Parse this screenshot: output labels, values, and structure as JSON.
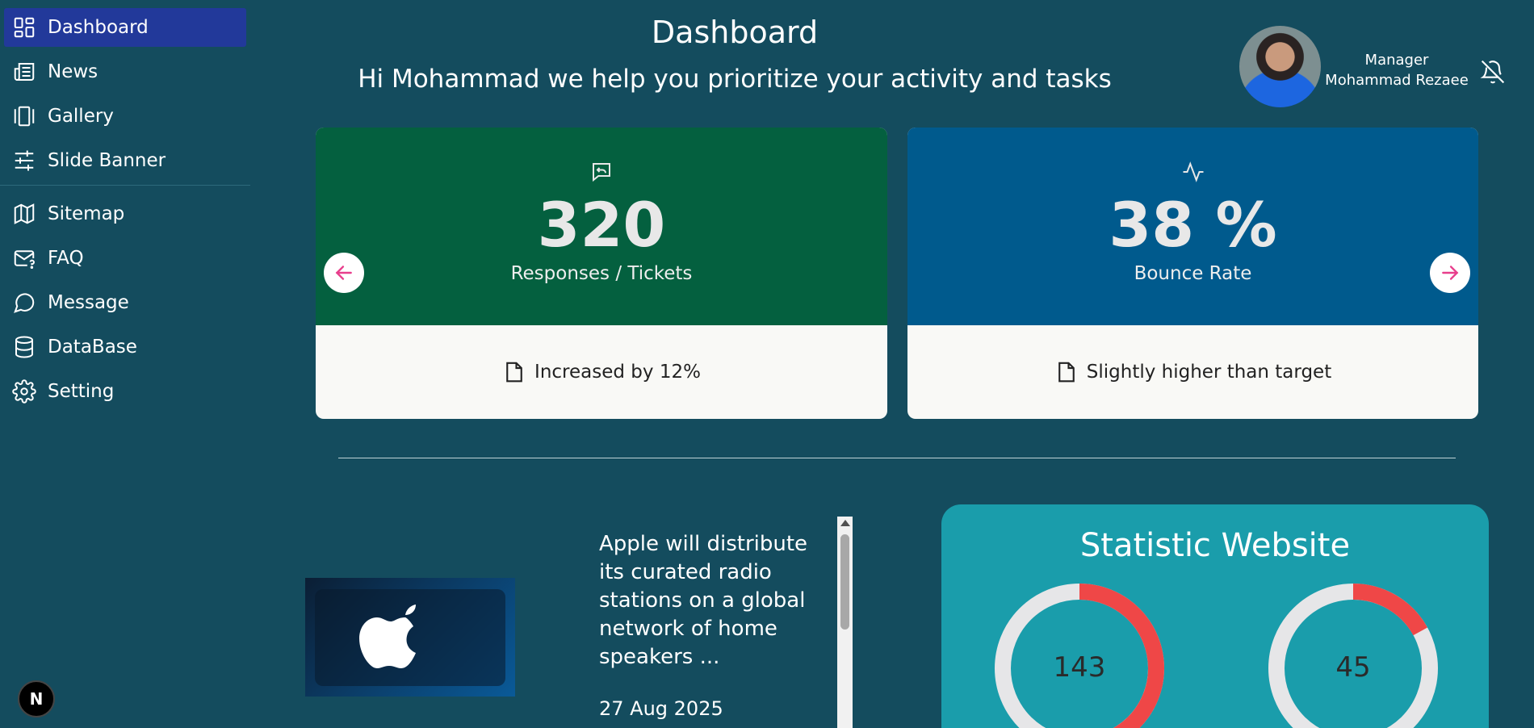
{
  "sidebar": {
    "items": [
      {
        "label": "Dashboard",
        "icon": "dashboard-icon"
      },
      {
        "label": "News",
        "icon": "news-icon"
      },
      {
        "label": "Gallery",
        "icon": "gallery-icon"
      },
      {
        "label": "Slide Banner",
        "icon": "sliders-icon"
      },
      {
        "label": "Sitemap",
        "icon": "map-icon"
      },
      {
        "label": "FAQ",
        "icon": "mail-question-icon"
      },
      {
        "label": "Message",
        "icon": "message-icon"
      },
      {
        "label": "DataBase",
        "icon": "database-icon"
      },
      {
        "label": "Setting",
        "icon": "gear-icon"
      }
    ],
    "logo_letter": "N"
  },
  "header": {
    "title": "Dashboard",
    "subtitle": "Hi Mohammad we help you prioritize your activity and tasks"
  },
  "user": {
    "role": "Manager",
    "name": "Mohammad Rezaee"
  },
  "cards": [
    {
      "value": "320",
      "label": "Responses / Tickets",
      "note": "Increased by 12%",
      "icon": "reply-message-icon",
      "color": "#04603f"
    },
    {
      "value": "38 %",
      "label": "Bounce Rate",
      "note": "Slightly higher than target",
      "icon": "activity-icon",
      "color": "#005a8d"
    }
  ],
  "news": {
    "title": "Apple will distribute its curated radio stations on a global network of home speakers ...",
    "date": "27 Aug 2025"
  },
  "stats": {
    "title": "Statistic Website",
    "items": [
      {
        "value": "143",
        "fraction": 0.42
      },
      {
        "value": "45",
        "fraction": 0.17
      }
    ]
  },
  "colors": {
    "background": "#144c5e",
    "active_nav": "#22399a",
    "stat_panel": "#1a9dab",
    "donut_fill": "#ef4747",
    "donut_track": "#e6e6e8",
    "arrow": "#e83e8c"
  }
}
